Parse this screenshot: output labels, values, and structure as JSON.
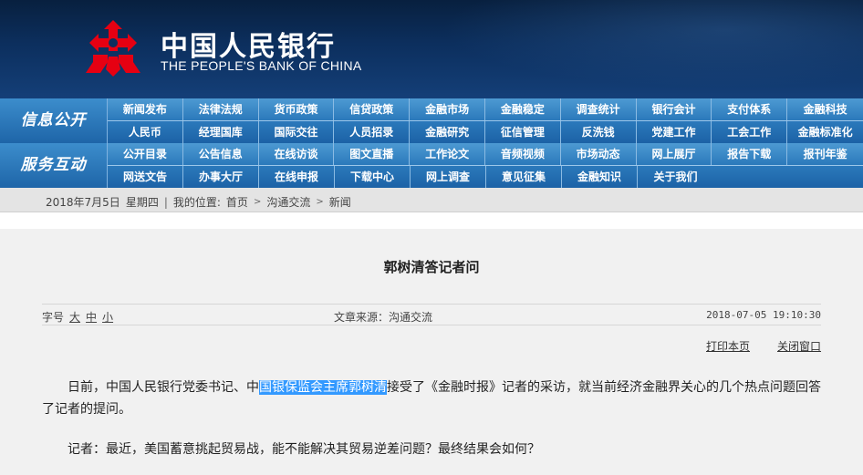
{
  "header": {
    "logo_cn": "中国人民银行",
    "logo_en": "THE PEOPLE'S BANK OF CHINA",
    "logo_color": "#e60012"
  },
  "nav": {
    "sections": [
      {
        "label": "信息公开",
        "rows": [
          [
            "新闻发布",
            "法律法规",
            "货币政策",
            "信贷政策",
            "金融市场",
            "金融稳定",
            "调查统计",
            "银行会计",
            "支付体系",
            "金融科技"
          ],
          [
            "人民币",
            "经理国库",
            "国际交往",
            "人员招录",
            "金融研究",
            "征信管理",
            "反洗钱",
            "党建工作",
            "工会工作",
            "金融标准化"
          ]
        ]
      },
      {
        "label": "服务互动",
        "rows": [
          [
            "公开目录",
            "公告信息",
            "在线访谈",
            "图文直播",
            "工作论文",
            "音频视频",
            "市场动态",
            "网上展厅",
            "报告下载",
            "报刊年鉴"
          ],
          [
            "网送文告",
            "办事大厅",
            "在线申报",
            "下载中心",
            "网上调查",
            "意见征集",
            "金融知识",
            "关于我们"
          ]
        ]
      }
    ]
  },
  "breadcrumb": {
    "date": "2018年7月5日",
    "weekday": "星期四",
    "sep": "|",
    "location_label": "我的位置:",
    "home": "首页",
    "level1": "沟通交流",
    "level2": "新闻",
    "arrow": ">"
  },
  "article": {
    "title": "郭树清答记者问",
    "font_label": "字号",
    "font_large": "大",
    "font_medium": "中",
    "font_small": "小",
    "source": "文章来源：沟通交流",
    "datetime": "2018-07-05  19:10:30",
    "print": "打印本页",
    "close": "关闭窗口",
    "para1_before": "日前，中国人民银行党委书记、中",
    "para1_highlight": "国银保监会主席郭树清",
    "para1_after": "接受了《金融时报》记者的采访，就当前经济金融界关心的几个热点问题回答了记者的提问。",
    "para2": "记者：最近，美国蓄意挑起贸易战，能不能解决其贸易逆差问题？最终结果会如何？"
  }
}
